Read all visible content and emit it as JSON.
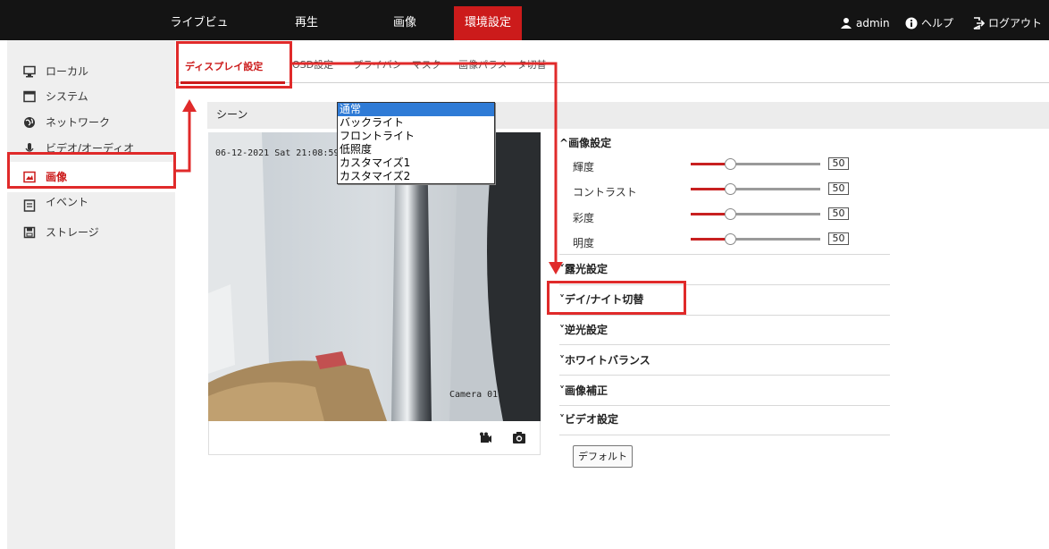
{
  "topnav": {
    "items": [
      "ライブビュー",
      "再生",
      "画像",
      "環境設定"
    ],
    "active_index": 3,
    "user": "admin",
    "help": "ヘルプ",
    "logout": "ログアウト"
  },
  "sidebar": {
    "items": [
      {
        "label": "ローカル",
        "icon": "monitor-icon"
      },
      {
        "label": "システム",
        "icon": "window-icon"
      },
      {
        "label": "ネットワーク",
        "icon": "globe-icon"
      },
      {
        "label": "ビデオ/オーディオ",
        "icon": "microphone-icon"
      },
      {
        "label": "画像",
        "icon": "image-icon"
      },
      {
        "label": "イベント",
        "icon": "list-icon"
      },
      {
        "label": "ストレージ",
        "icon": "disk-icon"
      }
    ],
    "active_index": 4
  },
  "tabs": {
    "items": [
      "ディスプレイ設定",
      "OSD設定",
      "プライバシーマスク",
      "画像パラメータ切替"
    ],
    "active_index": 0
  },
  "scene": {
    "label": "シーン",
    "options": [
      "通常",
      "バックライト",
      "フロントライト",
      "低照度",
      "カスタマイズ1",
      "カスタマイズ2"
    ],
    "selected": "通常"
  },
  "video": {
    "osd_time": "06-12-2021 Sat 21:08:59",
    "camera_name": "Camera 01"
  },
  "image_settings": {
    "header": "画像設定",
    "rows": [
      {
        "label": "輝度",
        "value": "50",
        "level": 0.5
      },
      {
        "label": "コントラスト",
        "value": "50",
        "level": 0.5
      },
      {
        "label": "彩度",
        "value": "50",
        "level": 0.5
      },
      {
        "label": "明度",
        "value": "50",
        "level": 0.5
      }
    ]
  },
  "sections": [
    "露光設定",
    "デイ/ナイト切替",
    "逆光設定",
    "ホワイトバランス",
    "画像補正",
    "ビデオ設定"
  ],
  "default_button": "デフォルト",
  "colors": {
    "accent": "#cc1b1b",
    "topbar": "#141414",
    "annotation": "#e02a2a",
    "selection": "#2f7bd6"
  }
}
